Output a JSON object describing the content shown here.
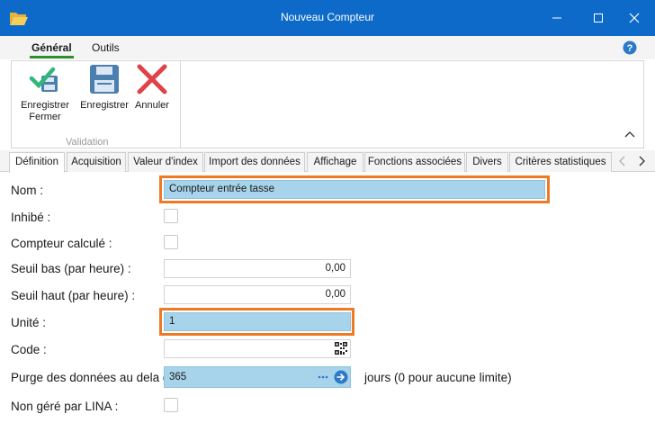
{
  "window": {
    "title": "Nouveau Compteur",
    "app_icon": "folder-open-icon",
    "controls": [
      "minimize-icon",
      "maximize-icon",
      "close-icon"
    ]
  },
  "ribbon": {
    "tabs": [
      {
        "label": "Général",
        "active": true
      },
      {
        "label": "Outils",
        "active": false
      }
    ],
    "buttons": [
      {
        "label": "Enregistrer\nFermer",
        "icon": "save-close-icon"
      },
      {
        "label": "Enregistrer",
        "icon": "save-icon"
      },
      {
        "label": "Annuler",
        "icon": "cancel-icon"
      }
    ],
    "group_label": "Validation",
    "help_icon": "help-icon"
  },
  "tabs": [
    {
      "label": "Définition",
      "active": true
    },
    {
      "label": "Acquisition"
    },
    {
      "label": "Valeur d'index"
    },
    {
      "label": "Import des données"
    },
    {
      "label": "Affichage"
    },
    {
      "label": "Fonctions associées"
    },
    {
      "label": "Divers"
    },
    {
      "label": "Critères statistiques"
    }
  ],
  "form": {
    "nom": {
      "label": "Nom :",
      "value": "Compteur entrée tasse"
    },
    "inhibe": {
      "label": "Inhibé :",
      "checked": false
    },
    "compteur_calcule": {
      "label": "Compteur calculé :",
      "checked": false
    },
    "seuil_bas": {
      "label": "Seuil bas (par heure) :",
      "value": "0,00"
    },
    "seuil_haut": {
      "label": "Seuil haut (par heure) :",
      "value": "0,00"
    },
    "unite": {
      "label": "Unité :",
      "value": "1"
    },
    "code": {
      "label": "Code :",
      "value": ""
    },
    "purge": {
      "label": "Purge des données au dela de",
      "value": "365",
      "suffix": "jours  (0 pour aucune limite)"
    },
    "non_gere": {
      "label": "Non géré par LINA :",
      "checked": false
    }
  },
  "colors": {
    "titlebar": "#0d6ac8",
    "highlight_field": "#a7d4ea",
    "orange_frame": "#ee7a24",
    "active_tab_underline": "#2f8f2f"
  }
}
